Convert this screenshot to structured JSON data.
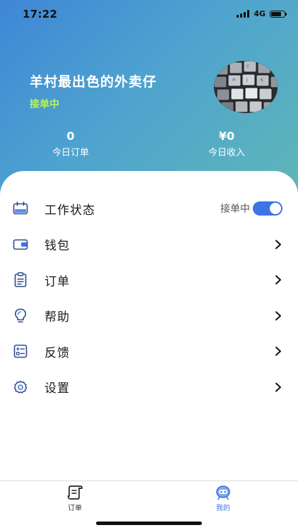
{
  "status_bar": {
    "time": "17:22",
    "network": "4G"
  },
  "profile": {
    "name": "羊村最出色的外卖仔",
    "status": "接单中",
    "avatar": "keyboard-photo"
  },
  "stats": {
    "orders": {
      "value": "0",
      "label": "今日订单"
    },
    "income": {
      "value": "¥0",
      "label": "今日收入"
    }
  },
  "menu": {
    "work_status": {
      "label": "工作状态",
      "value": "接单中",
      "toggle_on": true,
      "icon": "calendar-icon"
    },
    "wallet": {
      "label": "钱包",
      "icon": "wallet-icon"
    },
    "orders": {
      "label": "订单",
      "icon": "clipboard-icon"
    },
    "help": {
      "label": "帮助",
      "icon": "lightbulb-icon"
    },
    "feedback": {
      "label": "反馈",
      "icon": "feedback-card-icon"
    },
    "settings": {
      "label": "设置",
      "icon": "gear-icon"
    }
  },
  "tabbar": {
    "orders": {
      "label": "订单",
      "icon": "scroll-icon"
    },
    "mine": {
      "label": "我的",
      "icon": "robot-face-icon",
      "active": true
    }
  },
  "colors": {
    "gradient_start": "#3f86d6",
    "gradient_end": "#5fb7b6",
    "accent": "#3d74e6",
    "status_green": "#b9f25c"
  }
}
